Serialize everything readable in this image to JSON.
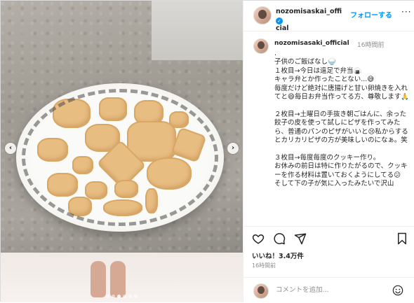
{
  "post": {
    "username_line1": "nozomisaskai_offi",
    "username_line2": "cial",
    "follow_label": "フォローする",
    "more_label": "···"
  },
  "caption": {
    "username": "nozomisasaki_official",
    "time": "16時間前",
    "text": ".\n子供のご飯ばなし🍚\n１枚目→今日は遠足で弁当🍙\nキャラ弁とか作ったことない...😅\n毎度だけど絶対に唐揚げと甘い卵焼きを入れてと😄毎日お弁当作ってる方、尊敬します🙏\n\n２枚目→土曜日の手抜き朝ごはんに、余った餃子の皮を使って試しにピザを作ってみたら、普通のパンのピザがいいと😢私からするとカリカリピザの方が美味しいのになぁ。笑\n\n３枚目→毎度毎度のクッキー作り。\nお休みの前日は特に作りたがるので、クッキーを作る材料は置いておくようにしてる😕\nそして下の子が気に入ったみたいで沢山"
  },
  "actions": {
    "likes": "いいね！3.4万件",
    "time_ago": "16時間前"
  },
  "comment": {
    "placeholder": "コメントを追加..."
  },
  "photo": {
    "dot_count": 6,
    "active_dot": 2
  },
  "colors": {
    "accent": "#0095f6",
    "cookie": "#e8bd82"
  }
}
